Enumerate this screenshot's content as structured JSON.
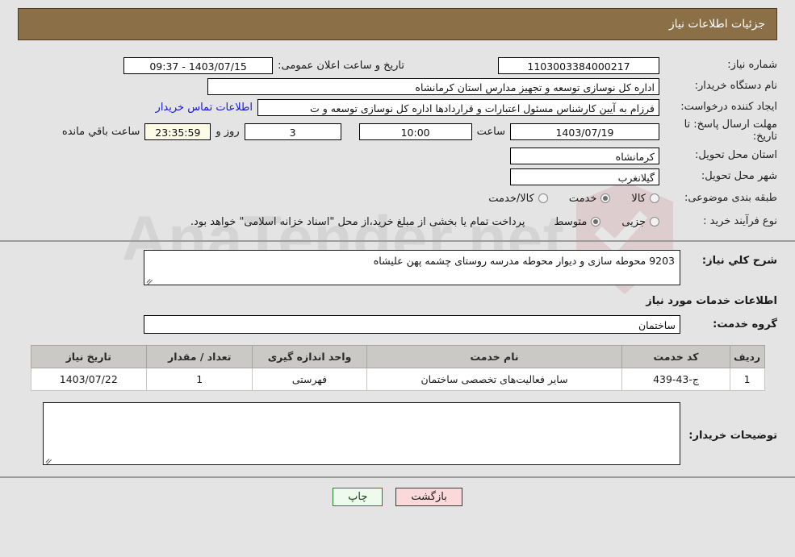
{
  "header": {
    "title": "جزئیات اطلاعات نیاز",
    "bg_color": "#8b6f47",
    "text_color": "#ffffff"
  },
  "watermark": {
    "text": "AnaTender.net"
  },
  "info": {
    "need_number_label": "شماره نیاز:",
    "need_number_value": "1103003384000217",
    "announce_datetime_label": "تاریخ و ساعت اعلان عمومی:",
    "announce_datetime_value": "1403/07/15 - 09:37",
    "buyer_org_label": "نام دستگاه خریدار:",
    "buyer_org_value": "اداره کل نوسازی  توسعه و تجهیز مدارس استان کرمانشاه",
    "requester_label": "ایجاد کننده درخواست:",
    "requester_value": "فرزام به آیین کارشناس مسئول اعتبارات و قراردادها اداره کل نوسازی  توسعه و ت",
    "buyer_contact_link": "اطلاعات تماس خریدار",
    "deadline_label": "مهلت ارسال پاسخ: تا تاریخ:",
    "deadline_date": "1403/07/19",
    "hour_label": "ساعت",
    "deadline_time": "10:00",
    "days_value": "3",
    "days_label": "روز و",
    "countdown_value": "23:35:59",
    "remaining_label": "ساعت باقي مانده",
    "province_label": "استان محل تحویل:",
    "province_value": "کرمانشاه",
    "city_label": "شهر محل تحویل:",
    "city_value": "گیلانغرب",
    "classification_label": "طبقه بندی موضوعی:",
    "classification_options": [
      {
        "label": "کالا",
        "selected": false
      },
      {
        "label": "خدمت",
        "selected": true
      },
      {
        "label": "کالا/خدمت",
        "selected": false
      }
    ],
    "purchase_type_label": "نوع فرآیند خرید :",
    "purchase_type_options": [
      {
        "label": "جزیی",
        "selected": false
      },
      {
        "label": "متوسط",
        "selected": true
      }
    ],
    "payment_note": "پرداخت تمام یا بخشی از مبلغ خرید،از محل \"اسناد خزانه اسلامی\" خواهد بود."
  },
  "need_description": {
    "label": "شرح کلي نیاز:",
    "value": "9203 محوطه سازی  و دیوار محوطه مدرسه روستای چشمه پهن علیشاه"
  },
  "services_section": {
    "heading": "اطلاعات خدمات مورد نیاز",
    "group_label": "گروه خدمت:",
    "group_value": "ساختمان"
  },
  "items_table": {
    "columns": [
      "ردیف",
      "کد خدمت",
      "نام خدمت",
      "واحد اندازه گیری",
      "تعداد / مقدار",
      "تاریخ نیاز"
    ],
    "rows": [
      {
        "index": "1",
        "code": "ج-43-439",
        "name": "سایر فعالیت‌های تخصصی ساختمان",
        "unit": "فهرستی",
        "quantity": "1",
        "need_date": "1403/07/22"
      }
    ]
  },
  "buyer_comments": {
    "label": "توضیحات خریدار:",
    "value": ""
  },
  "footer": {
    "print_label": "چاپ",
    "back_label": "بازگشت"
  }
}
